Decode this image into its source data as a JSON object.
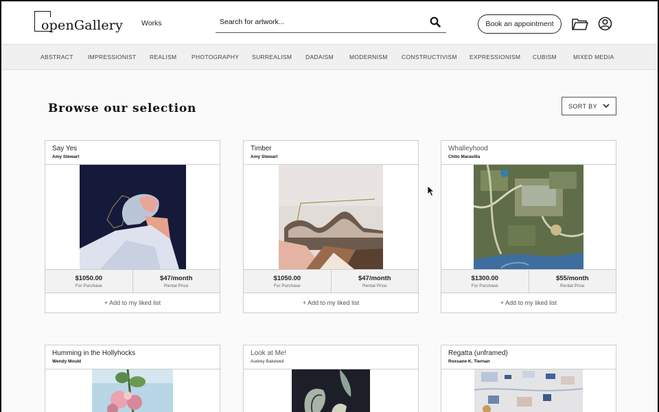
{
  "header": {
    "logo_text": "openGallery",
    "nav_works": "Works",
    "search_placeholder": "Search for artwork...",
    "book_button": "Book an appointment"
  },
  "categories": [
    "ABSTRACT",
    "IMPRESSIONIST",
    "REALISM",
    "PHOTOGRAPHY",
    "SURREALISM",
    "DADAISM",
    "MODERNISM",
    "CONSTRUCTIVISM",
    "EXPRESSIONISM",
    "CUBISM",
    "MIXED MEDIA"
  ],
  "main": {
    "title": "Browse our selection",
    "sort_label": "SORT BY"
  },
  "cards": [
    {
      "title": "Say Yes",
      "artist": "Amy Stewart",
      "price": "$1050.00",
      "price_label": "For Purchase",
      "rental": "$47/month",
      "rental_label": "Rental Price",
      "like": "+ Add to my liked list"
    },
    {
      "title": "Timber",
      "artist": "Amy Stewart",
      "price": "$1050.00",
      "price_label": "For Purchase",
      "rental": "$47/month",
      "rental_label": "Rental Price",
      "like": "+ Add to my liked list"
    },
    {
      "title": "Whalleyhood",
      "artist": "Chito Maravilla",
      "price": "$1300.00",
      "price_label": "For Purchase",
      "rental": "$55/month",
      "rental_label": "Rental Price",
      "like": "+ Add to my liked list"
    },
    {
      "title": "Humming in the Hollyhocks",
      "artist": "Wendy Mould"
    },
    {
      "title": "Look at Me!",
      "artist": "Audrey Bakewell"
    },
    {
      "title": "Regatta (unframed)",
      "artist": "Roxsane K. Tiernan"
    }
  ],
  "colors": {
    "accent": "#111111",
    "card_border": "#cccccc",
    "category_bar": "#f0f0f0",
    "price_row": "#f2f2f2"
  },
  "icons": [
    "search-icon",
    "folder-icon",
    "user-icon",
    "chevron-down-icon",
    "cursor-icon"
  ]
}
